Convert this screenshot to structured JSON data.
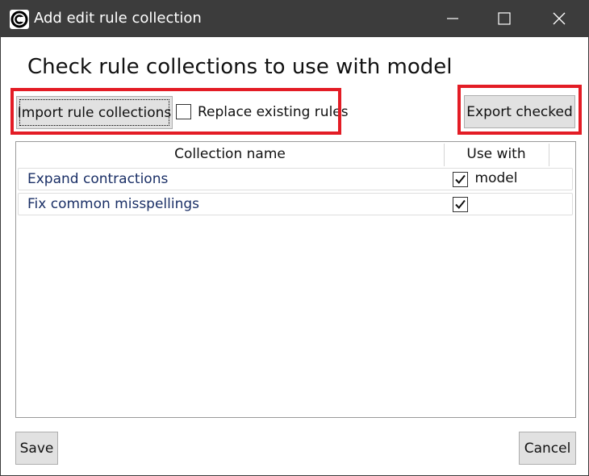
{
  "window": {
    "title": "Add edit rule collection"
  },
  "heading": "Check rule collections to use with model",
  "toolbar": {
    "import_label": "Import rule collections",
    "replace_label": "Replace existing rules",
    "replace_checked": false,
    "export_label": "Export checked"
  },
  "table": {
    "columns": [
      "Collection name",
      "Use with model"
    ],
    "rows": [
      {
        "name": "Expand contractions",
        "use": true
      },
      {
        "name": "Fix common misspellings",
        "use": true
      }
    ]
  },
  "footer": {
    "save_label": "Save",
    "cancel_label": "Cancel"
  },
  "colors": {
    "titlebar": "#3c3c3c",
    "highlight": "#e31c25",
    "link_text": "#1a2f66",
    "button_face": "#e1e1e1"
  },
  "icons": [
    "app-logo-icon",
    "minimize-icon",
    "maximize-icon",
    "close-icon",
    "checkmark-icon"
  ]
}
